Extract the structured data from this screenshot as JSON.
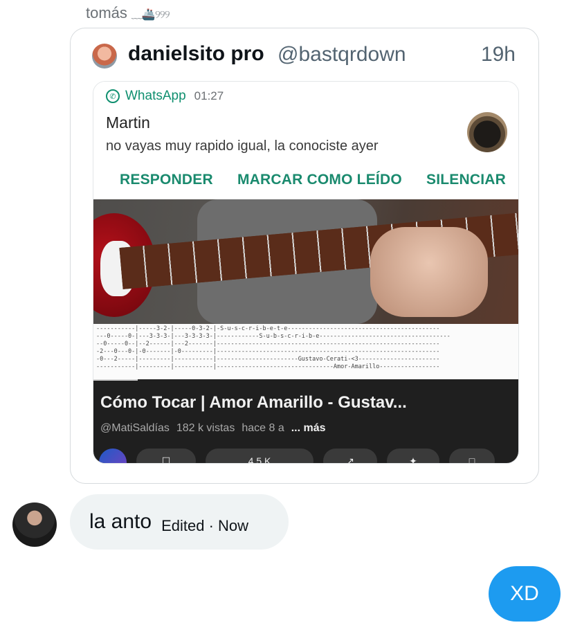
{
  "sender": {
    "name": "tomás",
    "decoration": "﹏🚢୨୨୨"
  },
  "quote": {
    "author": "danielsito pro",
    "handle": "@bastqrdown",
    "time": "19h",
    "notification": {
      "app": "WhatsApp",
      "time": "01:27",
      "from": "Martin",
      "message": "no vayas muy rapido igual, la conociste ayer",
      "actions": [
        "RESPONDER",
        "MARCAR COMO LEÍDO",
        "SILENCIAR"
      ]
    },
    "tab_text": "-----------|-----3-2-|-----0-3-2-|-S-u-s-c-r-i-b-e-t-e-------------------------------------------\n---0-----0-|---3-3-3-|---3-3-3-3-|------------S-u-b-s-c-r-i-b-e-------------------------------------\n--0-----0--|--2------|---2-------|---------------------------------------------------------------\n-2---0---0-|-0-------|-0---------|---------------------------------------------------------------\n-0---2-----|---------|-----------|-----------------------Gustavo-Cerati-<3-----------------------\n-----------|---------|-----------|---------------------------------Amor-Amarillo-----------------",
    "video": {
      "title": "Cómo Tocar | Amor Amarillo - Gustav...",
      "channel": "@MatiSaldías",
      "views": "182 k vistas",
      "age": "hace 8 a",
      "more": "... más",
      "likes": "4,5 K"
    }
  },
  "incoming": {
    "text": "la anto",
    "meta": "Edited · Now"
  },
  "outgoing": {
    "text": "XD"
  },
  "colors": {
    "accent": "#1d9bf0",
    "whatsapp_green": "#1a8a6e",
    "bubble_gray": "#eff3f4"
  }
}
